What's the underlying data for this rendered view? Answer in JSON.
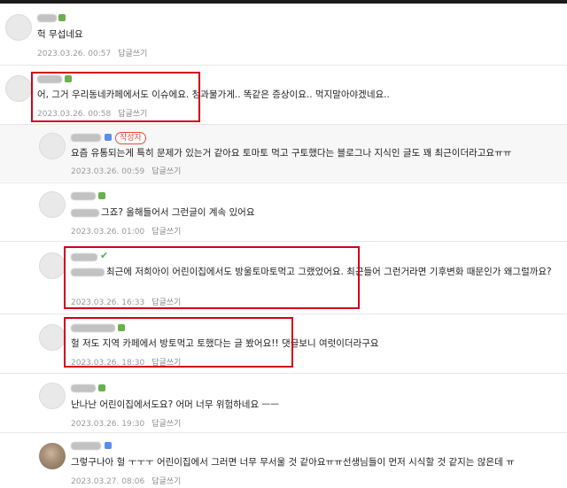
{
  "comments": [
    {
      "text": "헉 무섭네요",
      "date": "2023.03.26. 00:57",
      "reply_label": "답글쓰기"
    },
    {
      "text": "어, 그거 우리동네카페에서도 이슈에요. 청과물가게.. 똑같은 증상이요.. 먹지말아야겠네요..",
      "date": "2023.03.26. 00:58",
      "reply_label": "답글쓰기"
    },
    {
      "author_tag": "작성자",
      "text": "요즘 유통되는게 특히 문제가 있는거 같아요 토마토 먹고 구토했다는 블로그나 지식인 글도 꽤 최근이더라고요ㅠㅠ",
      "date": "2023.03.26. 00:59",
      "reply_label": "답글쓰기"
    },
    {
      "text": "그죠? 올해들어서 그런글이 계속 있어요",
      "date": "2023.03.26. 01:00",
      "reply_label": "답글쓰기"
    },
    {
      "text": "최근에 저희아이 어린이집에서도 방울토마토먹고 그랬었어요. 최근들어 그런거라면 기후변화 때문인가 왜그럴까요?",
      "date": "2023.03.26. 16:33",
      "reply_label": "답글쓰기"
    },
    {
      "text": "헐 저도 지역 카페에서 방토먹고 토했다는 글 봤어요!! 댓글보니 여럿이더라구요",
      "date": "2023.03.26. 18:30",
      "reply_label": "답글쓰기"
    },
    {
      "text": "난나난 어린이집에서도요? 어머 너무 위험하네요 ㅡㅡ",
      "date": "2023.03.26. 19:30",
      "reply_label": "답글쓰기"
    },
    {
      "text": "그렇구나아 헐 ㅜㅜㅜ 어린이집에서 그러면 너무 무서울 것 같아요ㅠㅠ선생님들이 먼저 시식할 것 같지는 않은데 ㅠ",
      "date": "2023.03.27. 08:06",
      "reply_label": "답글쓰기"
    }
  ]
}
